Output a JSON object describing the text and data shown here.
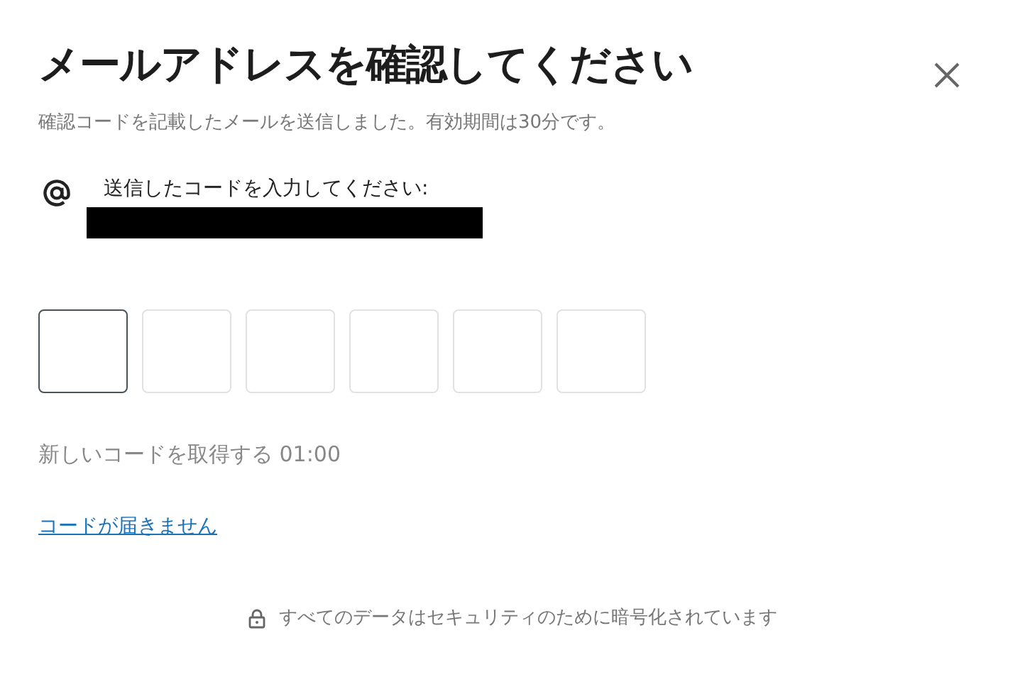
{
  "title": "メールアドレスを確認してください",
  "subtitle": "確認コードを記載したメールを送信しました。有効期間は30分です。",
  "recipient": {
    "label": "送信したコードを入力してください:",
    "redacted": true
  },
  "code_boxes": [
    {
      "focused": true
    },
    {
      "focused": false
    },
    {
      "focused": false
    },
    {
      "focused": false
    },
    {
      "focused": false
    },
    {
      "focused": false
    }
  ],
  "resend": "新しいコードを取得する 01:00",
  "help_link": "コードが届きません",
  "footer": "すべてのデータはセキュリティのために暗号化されています"
}
